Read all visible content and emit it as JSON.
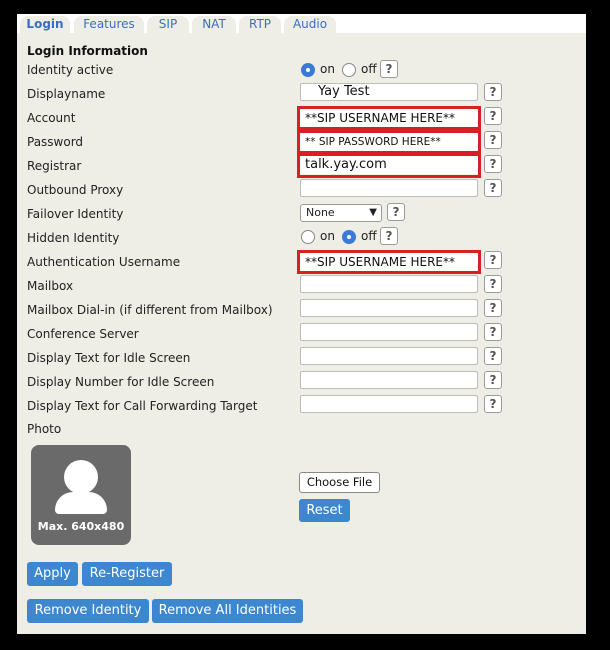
{
  "tabs": [
    "Login",
    "Features",
    "SIP",
    "NAT",
    "RTP",
    "Audio"
  ],
  "section_title": "Login Information",
  "rows": {
    "identity_active": {
      "label": "Identity active",
      "on": "on",
      "off": "off",
      "selected": "on"
    },
    "displayname": {
      "label": "Displayname",
      "value": "Yay Test"
    },
    "account": {
      "label": "Account",
      "value": "**SIP USERNAME HERE**"
    },
    "password": {
      "label": "Password",
      "value": "** SIP PASSWORD HERE**"
    },
    "registrar": {
      "label": "Registrar",
      "value": "talk.yay.com"
    },
    "outbound_proxy": {
      "label": "Outbound Proxy",
      "value": ""
    },
    "failover_identity": {
      "label": "Failover Identity",
      "value": "None"
    },
    "hidden_identity": {
      "label": "Hidden Identity",
      "on": "on",
      "off": "off",
      "selected": "off"
    },
    "auth_username": {
      "label": "Authentication Username",
      "value": "**SIP USERNAME HERE**"
    },
    "mailbox": {
      "label": "Mailbox",
      "value": ""
    },
    "mailbox_dialin": {
      "label": "Mailbox Dial-in (if different from Mailbox)",
      "value": ""
    },
    "conference_server": {
      "label": "Conference Server",
      "value": ""
    },
    "idle_text": {
      "label": "Display Text for Idle Screen",
      "value": ""
    },
    "idle_number": {
      "label": "Display Number for Idle Screen",
      "value": ""
    },
    "cf_text": {
      "label": "Display Text for Call Forwarding Target",
      "value": ""
    }
  },
  "photo": {
    "label": "Photo",
    "caption": "Max. 640x480",
    "choose_file": "Choose File",
    "reset": "Reset"
  },
  "help_symbol": "?",
  "buttons": {
    "apply": "Apply",
    "reregister": "Re-Register",
    "remove_identity": "Remove Identity",
    "remove_all": "Remove All Identities"
  },
  "colors": {
    "accent": "#3d87d0",
    "highlight": "#d91f26",
    "panel": "#eeede6"
  }
}
